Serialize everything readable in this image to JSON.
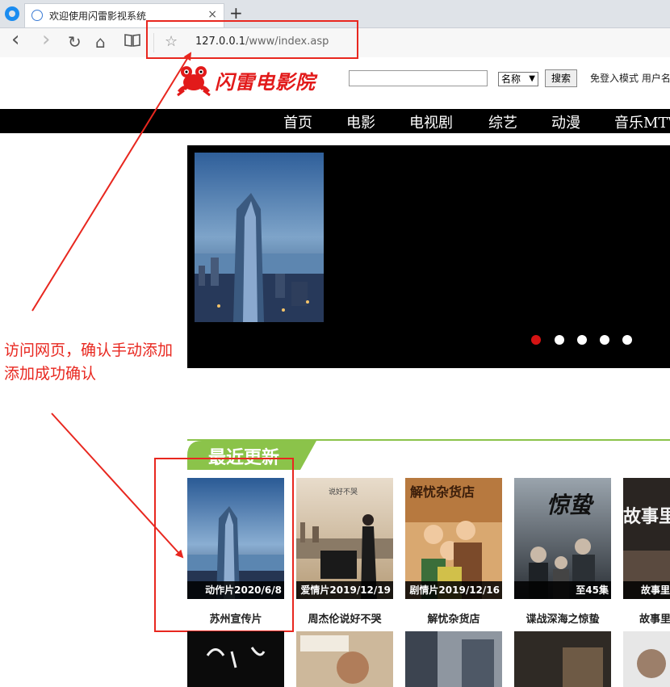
{
  "browser": {
    "tab_title": "欢迎使用闪雷影视系统",
    "tab_close": "×",
    "new_tab": "+",
    "back": "‹",
    "forward": "›",
    "refresh": "↻",
    "home": "⌂",
    "reader": "📖",
    "star": "☆",
    "url_host": "127.0.0.1",
    "url_path": "/www/index.asp"
  },
  "site": {
    "logo": "闪雷电影院",
    "search_placeholder": "",
    "search_option": "名称",
    "search_button": "搜索",
    "login_text": "免登入模式  用户名"
  },
  "nav": {
    "items": [
      "首页",
      "电影",
      "电视剧",
      "综艺",
      "动漫",
      "音乐MTV"
    ]
  },
  "annotation": {
    "line1": "访问网页，确认手动添加",
    "line2": "添加成功确认",
    "color": "#e8271f"
  },
  "section": {
    "title": "最近更新"
  },
  "cards": [
    {
      "caption": "动作片2020/6/8",
      "name": "苏州宣传片"
    },
    {
      "caption": "爱情片2019/12/19",
      "name": "周杰伦说好不哭"
    },
    {
      "caption": "剧情片2019/12/16",
      "name": "解忧杂货店"
    },
    {
      "caption": "至45集",
      "name": "谍战深海之惊蛰"
    },
    {
      "caption": "故事里",
      "name": "故事里"
    }
  ],
  "poster_texts": {
    "p2": "说好不哭",
    "p3": "解忧杂货店",
    "p4": "惊蛰",
    "p5": "故事里"
  }
}
